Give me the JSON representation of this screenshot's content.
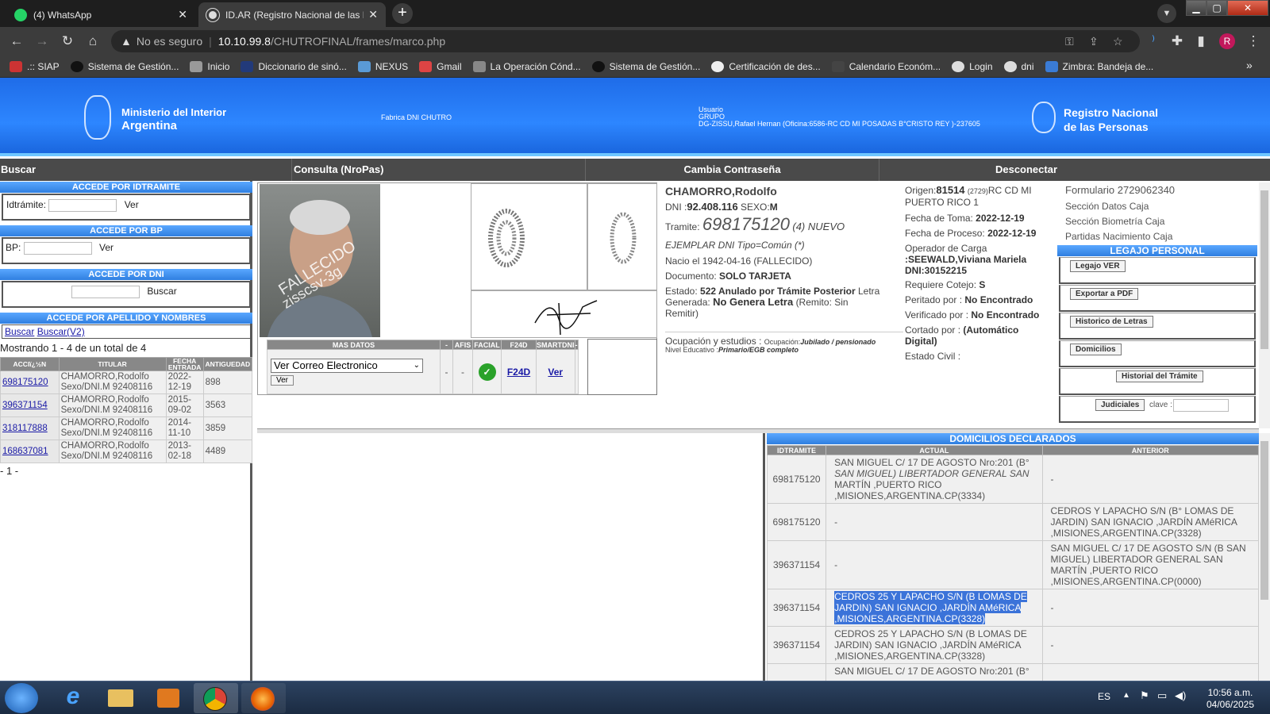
{
  "browser": {
    "tabs": [
      {
        "title": "(4) WhatsApp",
        "close": "✕"
      },
      {
        "title": "ID.AR (Registro Nacional de las P",
        "close": "✕"
      }
    ],
    "new_tab": "+",
    "address": {
      "security": "No es seguro",
      "host": "10.10.99.8",
      "path": "/CHUTROFINAL/frames/marco.php"
    },
    "bookmarks": [
      ".:: SIAP",
      "Sistema de Gestión...",
      "Inicio",
      "Diccionario de sinó...",
      "NEXUS",
      "Gmail",
      "La Operación Cónd...",
      "Sistema de Gestión...",
      "Certificación de des...",
      "Calendario Económ...",
      "Login",
      "dni",
      "Zimbra: Bandeja de..."
    ],
    "bookmarks_more": "»",
    "profile_initial": "R"
  },
  "header": {
    "ministry_line1": "Ministerio del Interior",
    "ministry_line2": "Argentina",
    "center": "Fabrica DNI CHUTRO",
    "user_l1": "Usuario",
    "user_l2": "GRUPO",
    "user_l3": "DG-ZISSU,Rafael Hernan (Oficina:6586-RC CD MI POSADAS B°CRISTO REY )-237605",
    "renaper_l1": "Registro Nacional",
    "renaper_l2": "de las Personas"
  },
  "menu": {
    "buscar": "Buscar",
    "consulta": "Consulta (NroPas)",
    "cambia": "Cambia Contraseña",
    "desconectar": "Desconectar"
  },
  "left": {
    "h_idtramite": "ACCEDE POR IDTRAMITE",
    "idtramite_label": "Idtrámite:",
    "ver": "Ver",
    "h_bp": "ACCEDE POR BP",
    "bp_label": "BP:",
    "h_dni": "ACCEDE POR DNI",
    "buscar": "Buscar",
    "h_apellido": "ACCEDE POR APELLIDO Y NOMBRES",
    "link_buscar": "Buscar",
    "link_buscar_v2": "Buscar(V2)",
    "mostrando": "Mostrando 1 - 4 de un total de 4",
    "cols": [
      "ACCIï¿½N",
      "TITULAR",
      "FECHA ENTRADA",
      "ANTIGUEDAD"
    ],
    "rows": [
      {
        "id": "698175120",
        "t1": "CHAMORRO,Rodolfo",
        "t2": "Sexo/DNI.M 92408116",
        "f1": "2022-",
        "f2": "12-19",
        "ant": "898"
      },
      {
        "id": "396371154",
        "t1": "CHAMORRO,Rodolfo",
        "t2": "Sexo/DNI.M 92408116",
        "f1": "2015-",
        "f2": "09-02",
        "ant": "3563"
      },
      {
        "id": "318117888",
        "t1": "CHAMORRO,Rodolfo",
        "t2": "Sexo/DNI.M 92408116",
        "f1": "2014-",
        "f2": "11-10",
        "ant": "3859"
      },
      {
        "id": "168637081",
        "t1": "CHAMORRO,Rodolfo",
        "t2": "Sexo/DNI.M 92408116",
        "f1": "2013-",
        "f2": "02-18",
        "ant": "4489"
      }
    ],
    "pager": "- 1 -"
  },
  "photo": {
    "stamp1": "FALLECIDO",
    "stamp2": "zisscsv-3g"
  },
  "mas_datos": {
    "cols": [
      "MAS DATOS",
      "-",
      "AFIS",
      "FACIAL",
      "F24D",
      "SMARTDNI",
      "-"
    ],
    "select": "Ver Correo Electronico",
    "ver": "Ver",
    "dash1": "-",
    "dash2": "-",
    "f24d": "F24D",
    "smart_ver": "Ver"
  },
  "person": {
    "name": "CHAMORRO,Rodolfo",
    "dni_label": "DNI :",
    "dni": "92.408.116",
    "sexo_label": "SEXO:",
    "sexo": "M",
    "tramite_label": "Tramite:",
    "tramite": "698175120",
    "tramite_suffix": "(4) NUEVO",
    "tramite_tipo": "EJEMPLAR DNI Tipo=Común (*)",
    "nacio": "Nacio el 1942-04-16 (FALLECIDO)",
    "documento_label": "Documento:",
    "documento": "SOLO TARJETA",
    "estado_label": "Estado:",
    "estado": "522 Anulado por Trámite Posterior",
    "letra_label": "Letra",
    "generada_label": "Generada:",
    "generada": "No Genera Letra",
    "remito": "(Remito: Sin",
    "remitido": "Remitir)",
    "ocupacion_label": "Ocupación y estudios :",
    "ocupacion_sub": "Ocupación:",
    "ocupacion": "Jubilado / pensionado",
    "nivel_label": "Nivel Educativo :",
    "nivel": "Primario/EGB completo"
  },
  "proceso": {
    "origen_label": "Origen:",
    "origen": "81514",
    "origen_code": "(2729)",
    "origen_rest": "RC CD MI",
    "origen_l2": "PUERTO RICO 1",
    "fecha_toma_label": "Fecha de Toma:",
    "fecha_toma": "2022-12-19",
    "fecha_proceso_label": "Fecha de Proceso:",
    "fecha_proceso": "2022-12-19",
    "operador_label": "Operador de Carga",
    "operador_l1": ":SEEWALD,Viviana Mariela",
    "operador_l2": "DNI:30152215",
    "cotejo_label": "Requiere Cotejo:",
    "cotejo": "S",
    "peritado_label": "Peritado por :",
    "peritado": "No Encontrado",
    "verificado_label": "Verificado por :",
    "verificado": "No Encontrado",
    "cortado_label": "Cortado por :",
    "cortado_l1": "(Automático",
    "cortado_l2": "Digital)",
    "estado_civil": "Estado Civil :"
  },
  "legajo": {
    "formulario": "Formulario 2729062340",
    "datos_caja": "Sección Datos Caja",
    "biometria_caja": "Sección Biometría Caja",
    "partidas_caja": "Partidas Nacimiento Caja",
    "header": "LEGAJO PERSONAL",
    "btn_ver": "Legajo VER",
    "btn_pdf": "Exportar a PDF",
    "btn_letras": "Historico de Letras",
    "btn_domicilios": "Domicilios",
    "btn_historial": "Historial del Trámite",
    "btn_judiciales": "Judiciales",
    "clave": "clave :"
  },
  "domicilios": {
    "header": "DOMICILIOS DECLARADOS",
    "cols": [
      "IDTRAMITE",
      "ACTUAL",
      "ANTERIOR"
    ],
    "rows": [
      {
        "id": "698175120",
        "a1": "SAN MIGUEL C/ 17 DE AGOSTO Nro:201 (B°",
        "a2": "SAN MIGUEL) LIBERTADOR GENERAL SAN",
        "a3": "MARTÍN ,PUERTO RICO",
        "a4": ",MISIONES,ARGENTINA.CP(3334)",
        "p1": "-"
      },
      {
        "id": "698175120",
        "a1": "-",
        "p1": "CEDROS Y LAPACHO S/N (B° LOMAS DE",
        "p2": "JARDIN) SAN IGNACIO ,JARDÍN AMéRICA",
        "p3": ",MISIONES,ARGENTINA.CP(3328)"
      },
      {
        "id": "396371154",
        "a1": "-",
        "p1": "SAN MIGUEL C/ 17 DE AGOSTO S/N (B SAN",
        "p2": "MIGUEL) LIBERTADOR GENERAL SAN",
        "p3": "MARTÍN ,PUERTO RICO",
        "p4": ",MISIONES,ARGENTINA.CP(0000)"
      },
      {
        "id": "396371154",
        "a1": "CEDROS 25 Y LAPACHO S/N (B LOMAS DE",
        "a2": "JARDIN) SAN IGNACIO ,JARDÍN AMéRICA",
        "a3": ",MISIONES,ARGENTINA.CP(3328)",
        "p1": "-"
      },
      {
        "id": "396371154",
        "a1": "CEDROS 25 Y LAPACHO S/N (B LOMAS DE",
        "a2": "JARDIN) SAN IGNACIO ,JARDÍN AMéRICA",
        "a3": ",MISIONES,ARGENTINA.CP(3328)",
        "p1": "-"
      },
      {
        "id": "",
        "a1": "SAN MIGUEL C/ 17 DE AGOSTO Nro:201 (B°",
        "p1": ""
      }
    ]
  },
  "taskbar": {
    "lang": "ES",
    "time": "10:56 a.m.",
    "date": "04/06/2025"
  }
}
